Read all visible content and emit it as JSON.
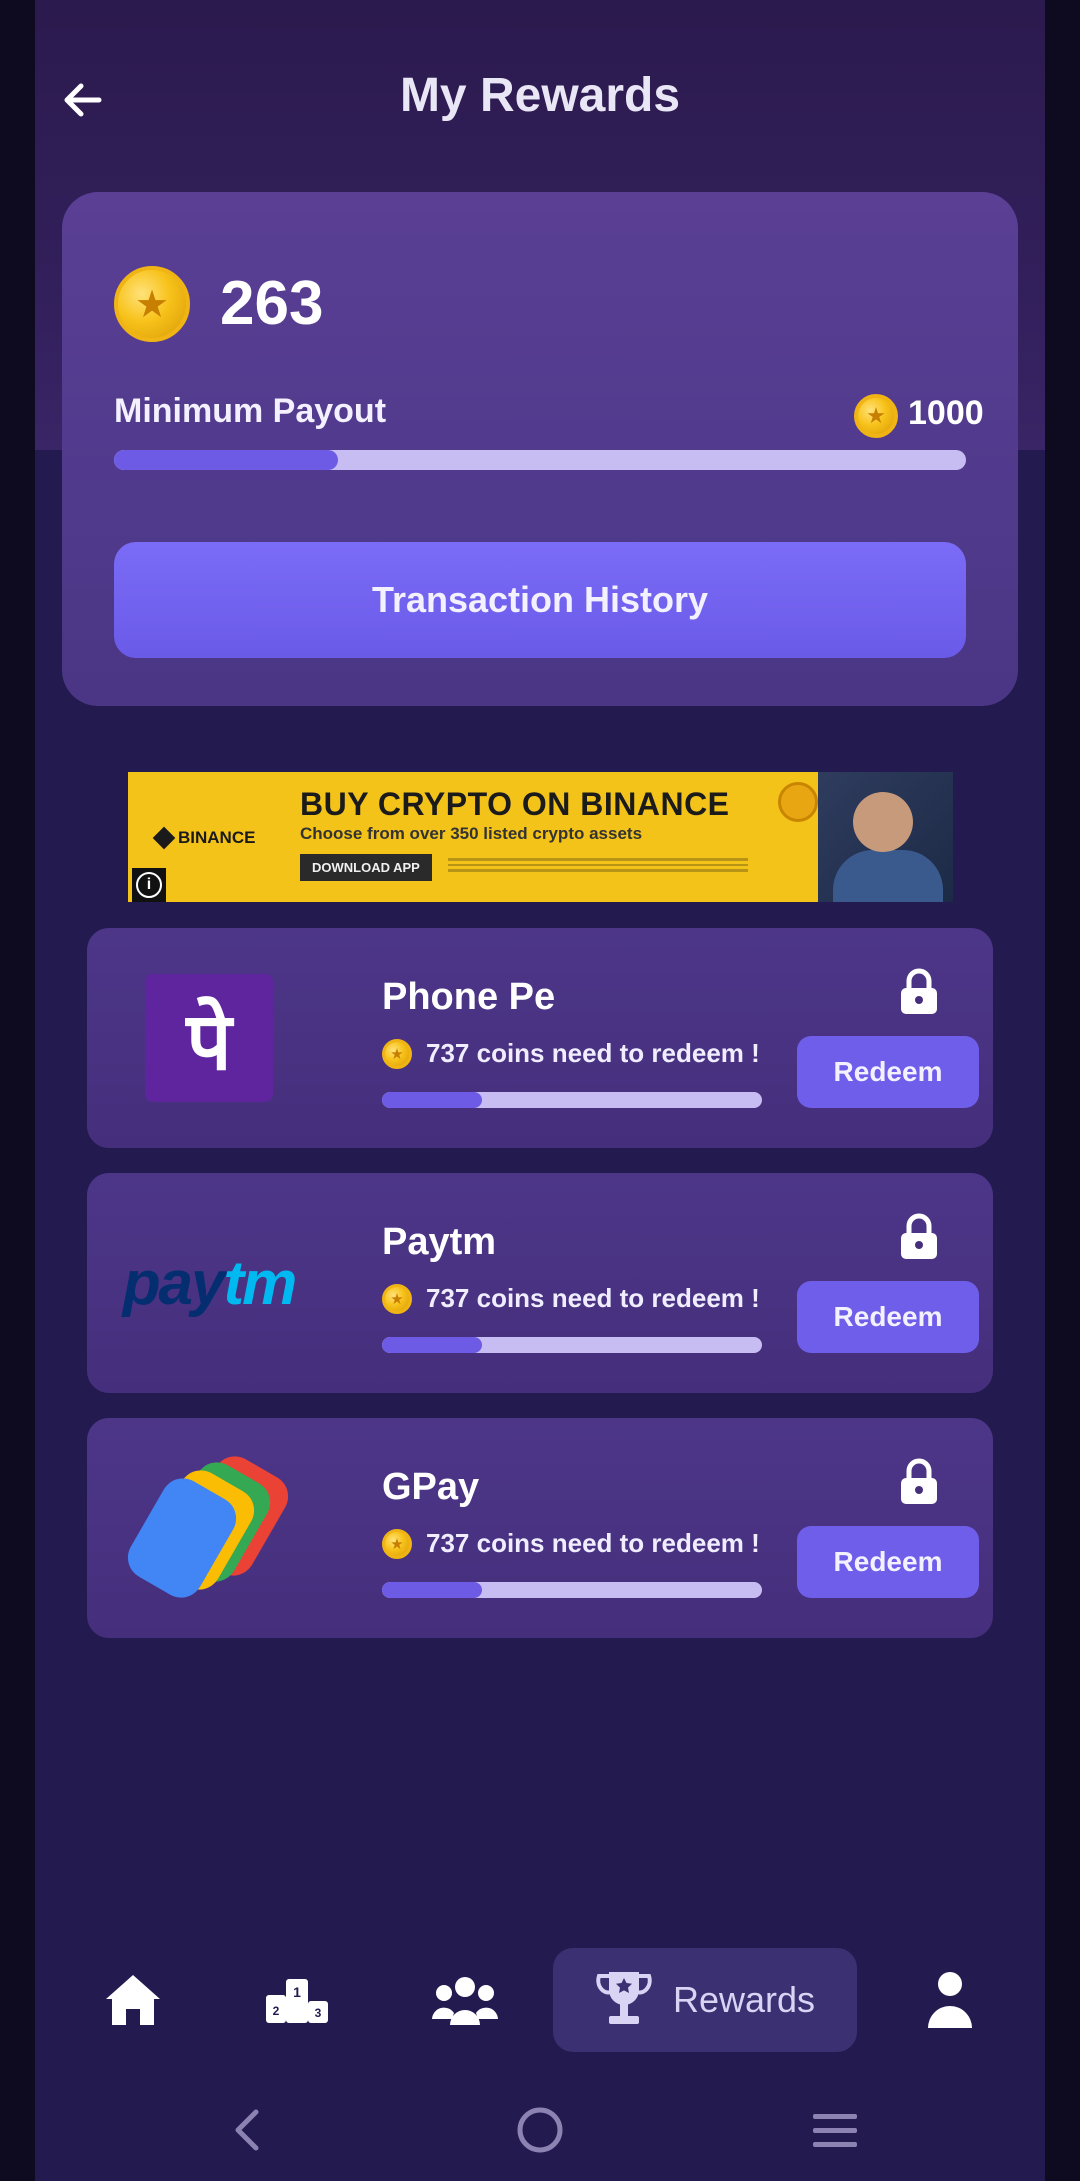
{
  "header": {
    "title": "My Rewards",
    "back_icon": "arrow-left-icon"
  },
  "balance": {
    "coins": "263",
    "min_payout_label": "Minimum Payout",
    "min_payout_value": "1000",
    "progress_fraction": 0.263,
    "transaction_button": "Transaction History"
  },
  "ad": {
    "brand": "BINANCE",
    "headline": "BUY CRYPTO ON BINANCE",
    "subline": "Choose from over 350 listed crypto assets",
    "cta": "DOWNLOAD APP",
    "info_glyph": "i"
  },
  "rewards": [
    {
      "name": "Phone Pe",
      "need_text": "737 coins need to redeem !",
      "progress_fraction": 0.263,
      "button": "Redeem",
      "logo_text": "पे"
    },
    {
      "name": "Paytm",
      "need_text": "737 coins need to redeem !",
      "progress_fraction": 0.263,
      "button": "Redeem",
      "logo_text_1": "pay",
      "logo_text_2": "tm"
    },
    {
      "name": "GPay",
      "need_text": "737 coins need to redeem !",
      "progress_fraction": 0.263,
      "button": "Redeem"
    }
  ],
  "nav": {
    "items": [
      "home-icon",
      "leaderboard-icon",
      "community-icon",
      "trophy-icon",
      "profile-icon"
    ],
    "active_label": "Rewards"
  },
  "colors": {
    "background": "#231a4f",
    "card": "#4d3688",
    "accent": "#6e5ee9",
    "progress_track": "#c8bdf2",
    "coin": "#f7c21a"
  }
}
